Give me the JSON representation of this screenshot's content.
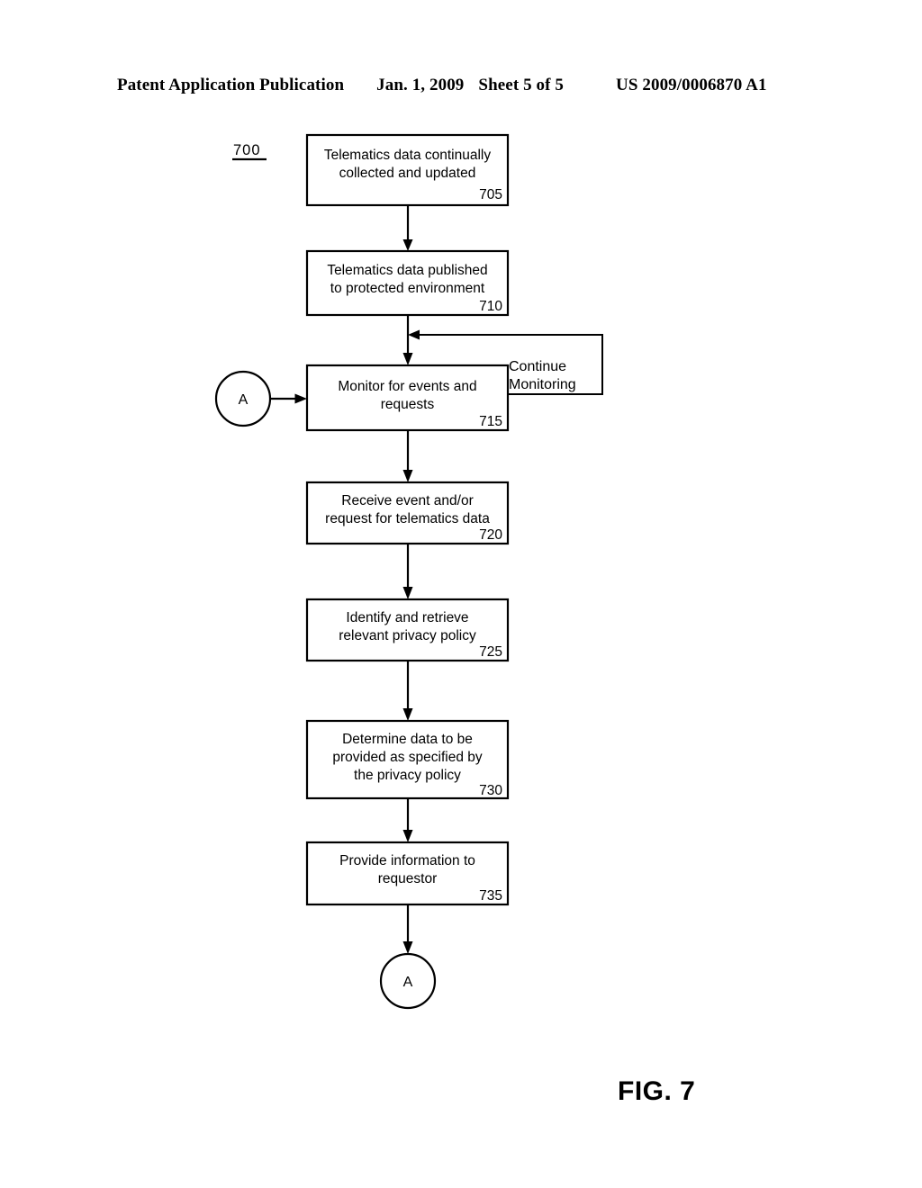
{
  "header": {
    "publication": "Patent Application Publication",
    "date": "Jan. 1, 2009",
    "sheet": "Sheet 5 of 5",
    "patent_number": "US 2009/0006870 A1"
  },
  "figure": {
    "caption": "FIG. 7",
    "diagram_label": "700"
  },
  "flowchart": {
    "boxes": [
      {
        "ref": "705",
        "lines": [
          "Telematics data continually",
          "collected and updated"
        ]
      },
      {
        "ref": "710",
        "lines": [
          "Telematics data published",
          "to protected environment"
        ]
      },
      {
        "ref": "715",
        "lines": [
          "Monitor for events and",
          "requests"
        ]
      },
      {
        "ref": "720",
        "lines": [
          "Receive event and/or",
          "request for telematics data"
        ]
      },
      {
        "ref": "725",
        "lines": [
          "Identify and retrieve",
          "relevant privacy policy"
        ]
      },
      {
        "ref": "730",
        "lines": [
          "Determine data to be",
          "provided as specified by",
          "the privacy policy"
        ]
      },
      {
        "ref": "735",
        "lines": [
          "Provide information to",
          "requestor"
        ]
      }
    ],
    "connectors": [
      {
        "id": "connector-a-top",
        "label": "A"
      },
      {
        "id": "connector-a-bottom",
        "label": "A"
      }
    ],
    "loop_label": {
      "line1": "Continue",
      "line2": "Monitoring"
    }
  }
}
